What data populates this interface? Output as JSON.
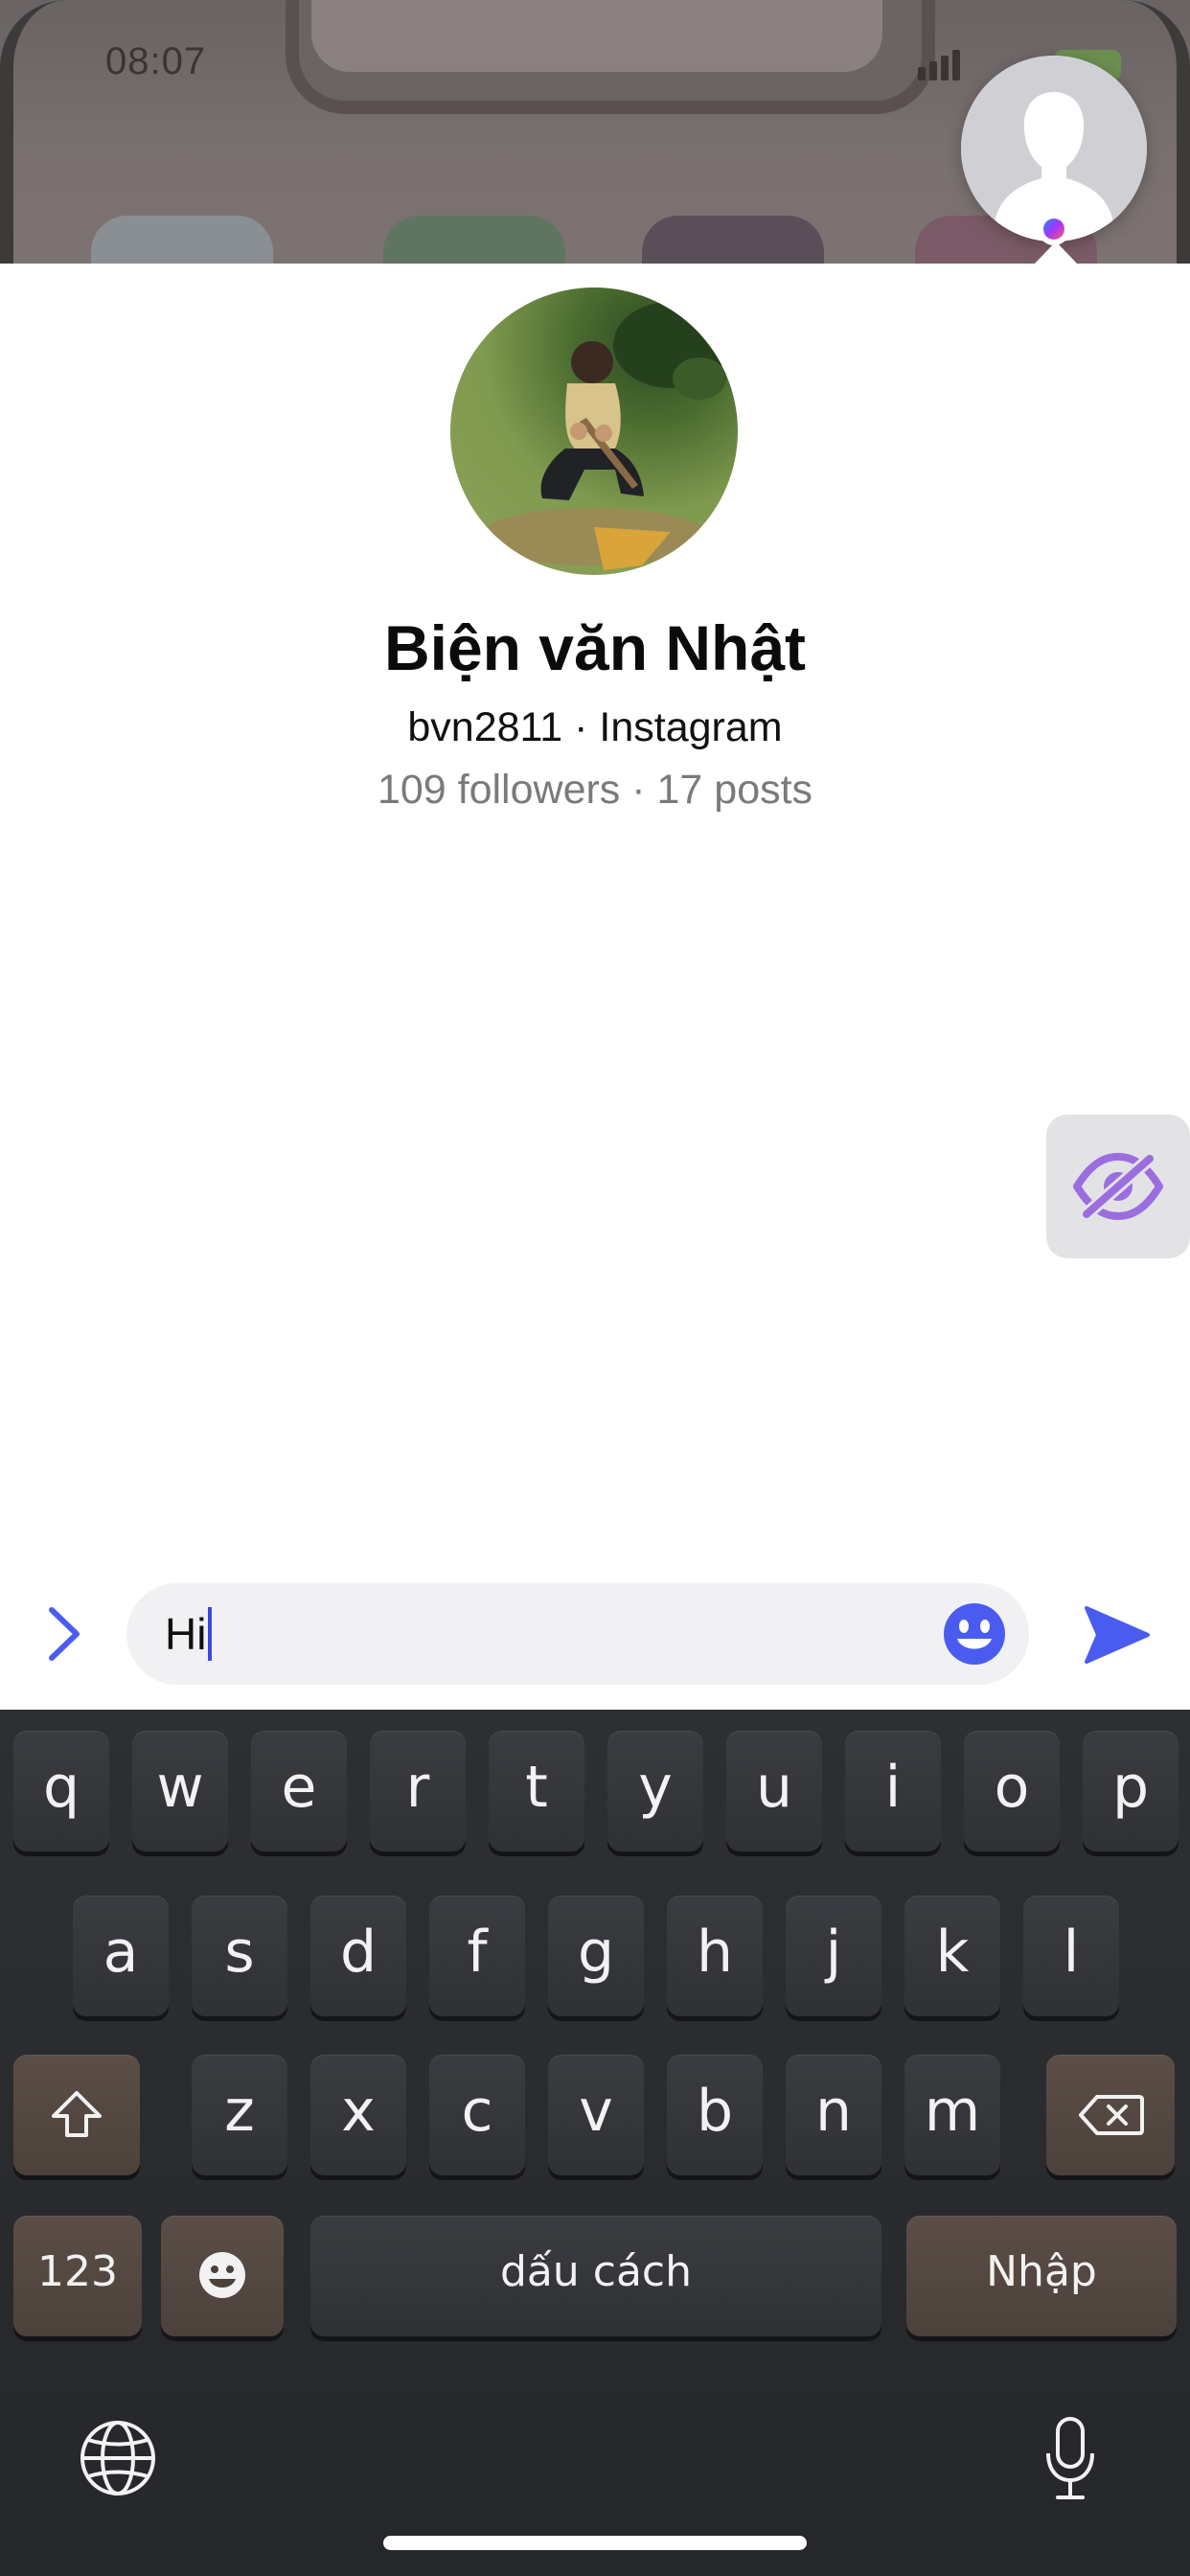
{
  "status_bar": {
    "time": "08:07"
  },
  "profile": {
    "name": "Biện văn Nhật",
    "handle_line": "bvn2811 · Instagram",
    "stats_line": "109 followers · 17 posts"
  },
  "composer": {
    "text": "Hi"
  },
  "keyboard": {
    "row1": [
      "q",
      "w",
      "e",
      "r",
      "t",
      "y",
      "u",
      "i",
      "o",
      "p"
    ],
    "row2": [
      "a",
      "s",
      "d",
      "f",
      "g",
      "h",
      "j",
      "k",
      "l"
    ],
    "row3": [
      "z",
      "x",
      "c",
      "v",
      "b",
      "n",
      "m"
    ],
    "numbers_label": "123",
    "space_label": "dấu cách",
    "return_label": "Nhập"
  },
  "colors": {
    "accent": "#4a5cf0",
    "hide_icon": "#9b6ee0",
    "keyboard_bg": "#2a2c30",
    "special_key": "#554842"
  },
  "icons": {
    "chathead": "person-silhouette-icon",
    "messenger_badge": "messenger-icon",
    "hide": "eye-slash-icon",
    "expand": "chevron-right-icon",
    "emoji": "smiley-icon",
    "send": "send-icon",
    "shift": "shift-icon",
    "delete": "backspace-icon",
    "keyboard_emoji": "emoji-key-icon",
    "globe": "globe-icon",
    "mic": "microphone-icon"
  }
}
